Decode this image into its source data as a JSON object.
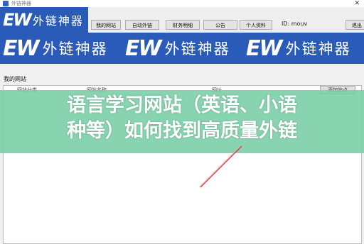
{
  "window": {
    "title": "外链神器"
  },
  "brand": {
    "logo": "EW",
    "name": "外链神器"
  },
  "nav": [
    {
      "label": "我的网站"
    },
    {
      "label": "自动外链"
    },
    {
      "label": "财务明细"
    },
    {
      "label": "公告"
    },
    {
      "label": "个人资料"
    }
  ],
  "user": {
    "id_label": "ID: mouv"
  },
  "logout_label": "退出",
  "section": {
    "title": "我的网站",
    "columns": [
      "网站分类",
      "网站名称",
      "网址"
    ],
    "add_button": "添加站点"
  },
  "overlay": {
    "line1": "语言学习网站（英语、小语",
    "line2": "种等）如何找到高质量外链"
  },
  "colors": {
    "banner": "#2a5bb8",
    "overlay": "#78cda5",
    "slash": "#d23a3a"
  }
}
